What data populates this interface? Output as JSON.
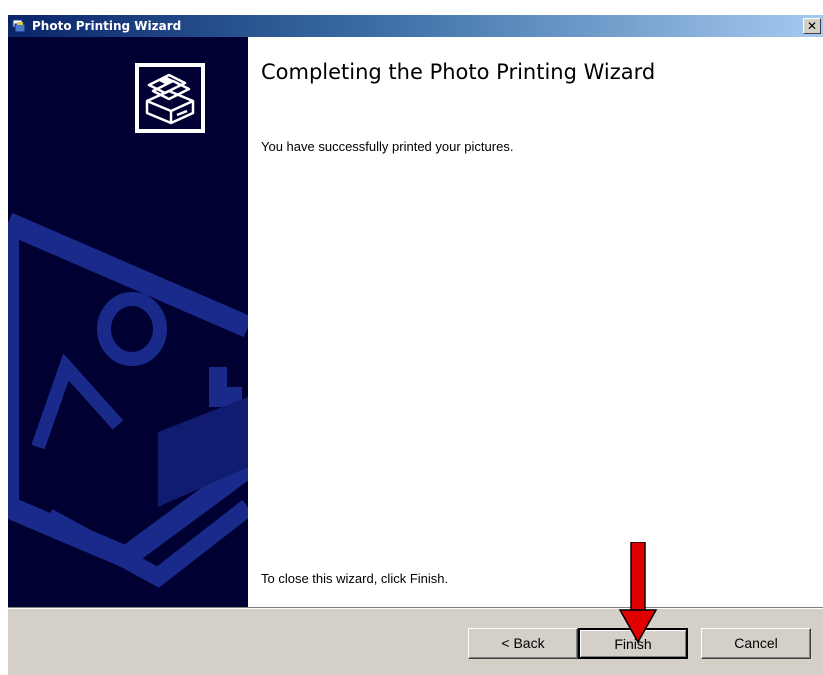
{
  "window": {
    "title": "Photo Printing Wizard",
    "close_glyph": "✕",
    "title_icon": "photo-printing-wizard-icon"
  },
  "banner": {
    "logo_icon": "printer-photos-icon",
    "background_art": "photo-frame-watermark"
  },
  "content": {
    "heading": "Completing the Photo Printing Wizard",
    "message": "You have successfully printed your pictures.",
    "close_hint": "To close this wizard, click Finish."
  },
  "buttons": {
    "back": "< Back",
    "finish": "Finish",
    "cancel": "Cancel"
  },
  "annotation": {
    "arrow_color": "#e00000",
    "points_to": "Finish"
  },
  "colors": {
    "banner_background": "#000033",
    "banner_art": "#1a2a8a",
    "title_gradient_start": "#0a246a",
    "title_gradient_end": "#a6caf0",
    "dialog_face": "#d4d0c8"
  }
}
